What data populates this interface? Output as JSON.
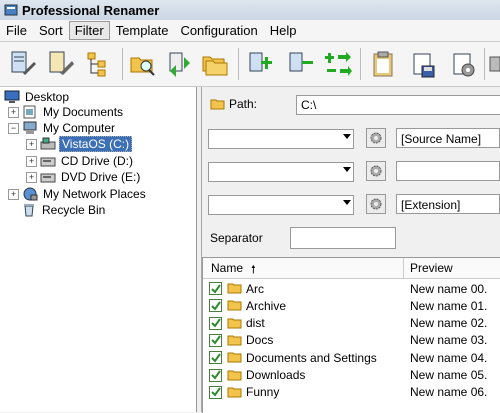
{
  "window": {
    "title": "Professional Renamer"
  },
  "menu": [
    "File",
    "Sort",
    "Filter",
    "Template",
    "Configuration",
    "Help"
  ],
  "menu_active": "Filter",
  "toolbar": [
    "rename-icon",
    "undo-icon",
    "tree-icon",
    "search-folder-icon",
    "refresh-icon",
    "folders-icon",
    "add-item-icon",
    "remove-item-icon",
    "move-icon",
    "clipboard-icon",
    "save-icon",
    "settings-icon"
  ],
  "tree": {
    "desktop": "Desktop",
    "my_documents": "My Documents",
    "my_computer": "My Computer",
    "vista": "VistaOS (C:)",
    "cd": "CD Drive (D:)",
    "dvd": "DVD Drive (E:)",
    "network": "My Network Places",
    "recycle": "Recycle Bin"
  },
  "panel": {
    "path_label": "Path:",
    "path_value": "C:\\",
    "field1": "[Source Name]",
    "field2": "",
    "field3": "[Extension]",
    "separator_label": "Separator",
    "separator_value": ""
  },
  "list": {
    "col_name": "Name",
    "col_preview": "Preview",
    "sort_arrow": "🠕",
    "rows": [
      {
        "name": "Arc",
        "preview": "New name 00."
      },
      {
        "name": "Archive",
        "preview": "New name 01."
      },
      {
        "name": "dist",
        "preview": "New name 02."
      },
      {
        "name": "Docs",
        "preview": "New name 03."
      },
      {
        "name": "Documents and Settings",
        "preview": "New name 04."
      },
      {
        "name": "Downloads",
        "preview": "New name 05."
      },
      {
        "name": "Funny",
        "preview": "New name 06."
      }
    ]
  },
  "colors": {
    "selection": "#3b6fb6",
    "folder": "#f2c44b",
    "check": "#2e8b2e"
  }
}
